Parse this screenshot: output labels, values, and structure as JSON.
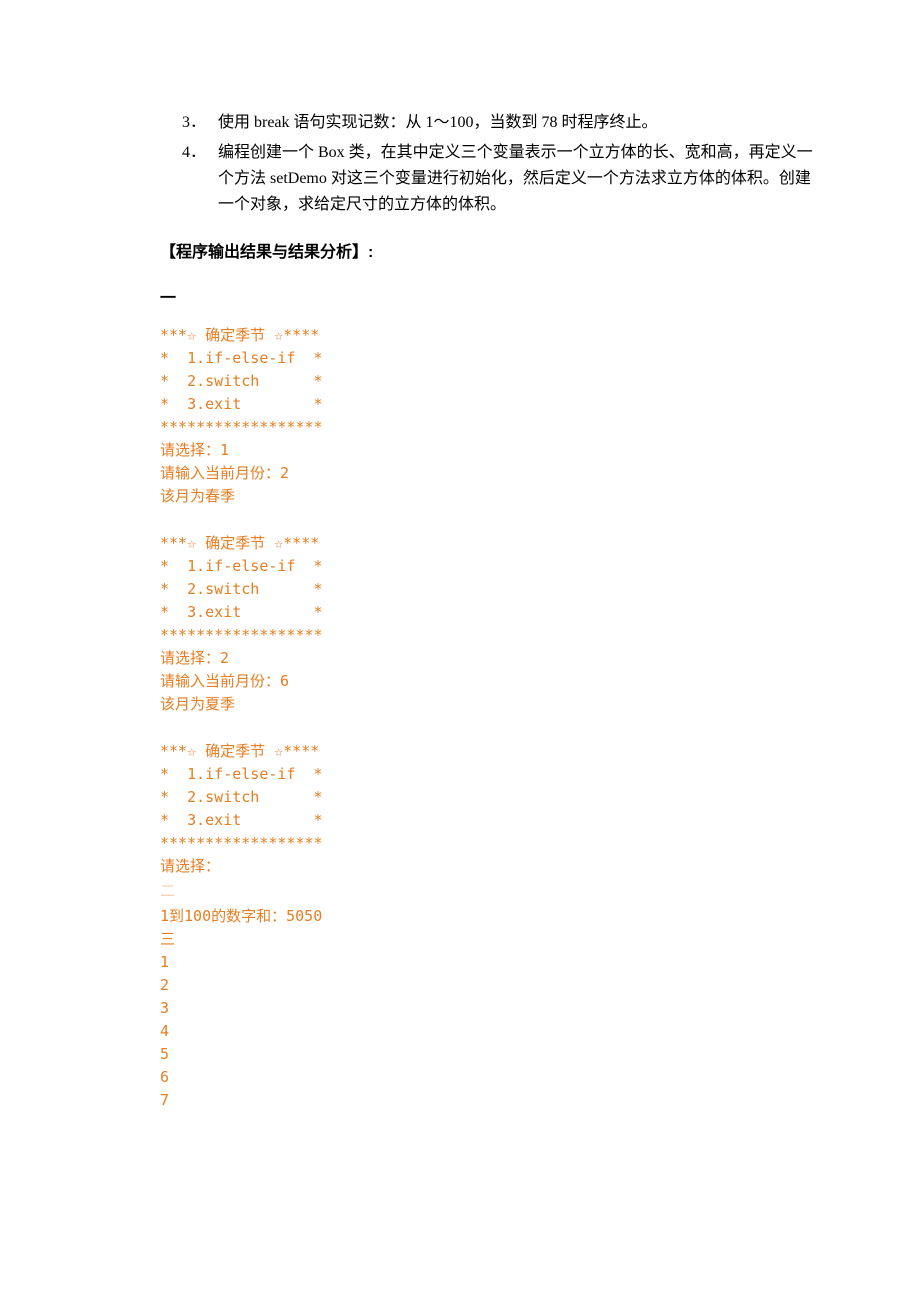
{
  "list": {
    "items": [
      {
        "num": "3．",
        "text": "使用 break 语句实现记数：从 1～100，当数到 78 时程序终止。"
      },
      {
        "num": "4．",
        "text": "编程创建一个 Box 类，在其中定义三个变量表示一个立方体的长、宽和高，再定义一个方法 setDemo 对这三个变量进行初始化，然后定义一个方法求立方体的体积。创建一个对象，求给定尺寸的立方体的体积。"
      }
    ]
  },
  "section_heading": "【程序输出结果与结果分析】:",
  "sub_label": "一",
  "output1": "***☆ 确定季节 ☆****\n*  1.if-else-if  *\n*  2.switch      *\n*  3.exit        *\n******************\n请选择：1\n请输入当前月份：2\n该月为春季",
  "output2": "***☆ 确定季节 ☆****\n*  1.if-else-if  *\n*  2.switch      *\n*  3.exit        *\n******************\n请选择：2\n请输入当前月份：6\n该月为夏季",
  "output3_part1": "***☆ 确定季节 ☆****\n*  1.if-else-if  *\n*  2.switch      *\n*  3.exit        *\n******************\n请选择：",
  "output3_faint": "二",
  "output3_part2": "1到100的数字和：5050\n三\n1\n2\n3\n4\n5\n6\n7"
}
